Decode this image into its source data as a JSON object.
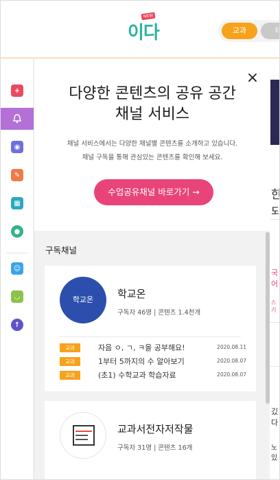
{
  "header": {
    "logo_text": "이다",
    "logo_badge": "NEW",
    "tabs": [
      {
        "label": "교과"
      },
      {
        "label": "테"
      }
    ]
  },
  "sidebar": {
    "items": [
      {
        "icon": "plus-folder-icon",
        "color": "#e84b61"
      },
      {
        "icon": "bell-icon",
        "color": "#b470d6",
        "active": true
      },
      {
        "icon": "target-icon",
        "color": "#6c6fe0"
      },
      {
        "icon": "edit-icon",
        "color": "#f07a4a"
      },
      {
        "icon": "class-board-icon",
        "color": "#2aa9c1"
      },
      {
        "icon": "cloud-icon",
        "color": "#30b38a"
      },
      {
        "icon": "teacher-icon",
        "color": "#3ba3e8"
      },
      {
        "icon": "smile-icon",
        "color": "#8bc34a"
      },
      {
        "icon": "cloud-upload-icon",
        "color": "#6052c9"
      }
    ]
  },
  "panel": {
    "title_line1": "다양한 콘텐츠의 공유 공간",
    "title_line2": "채널 서비스",
    "desc_line1": "채널 서비스에서는 다양한 채널별 콘텐츠를 소개하고 있습니다.",
    "desc_line2": "채널 구독을 통해 관심있는 콘텐츠를 확인해 보세요.",
    "cta_label": "수업공유채널 바로가기 →",
    "close_label": "×",
    "section_label": "구독채널"
  },
  "channels": [
    {
      "name": "학교온",
      "logo_text": "학교온",
      "meta": "구독자 46명  |  콘텐츠 1.4천개",
      "posts": [
        {
          "badge": "교과",
          "title": "자음 ㅇ, ㄱ, ㅋ을 공부해요!",
          "date": "2020.08.11"
        },
        {
          "badge": "교과",
          "title": "1부터 5까지의 수 알아보기",
          "date": "2020.08.07"
        },
        {
          "badge": "교과",
          "title": "(초1) 수학교과 학습자료",
          "date": "2020.08.07"
        }
      ]
    },
    {
      "name": "교과서전자저작물",
      "meta": "구독자 31명  |  콘텐츠 16개",
      "posts": []
    }
  ],
  "background": {
    "frag1": "한 되",
    "frag2": "국어",
    "frag3": "스기",
    "frag4": "깄다",
    "frag5": "노 있"
  },
  "colors": {
    "accent_orange": "#f7a21c",
    "cta_pink": "#e8447a",
    "sidebar_active": "#b470d6",
    "brand_teal": "#2ab39d"
  }
}
